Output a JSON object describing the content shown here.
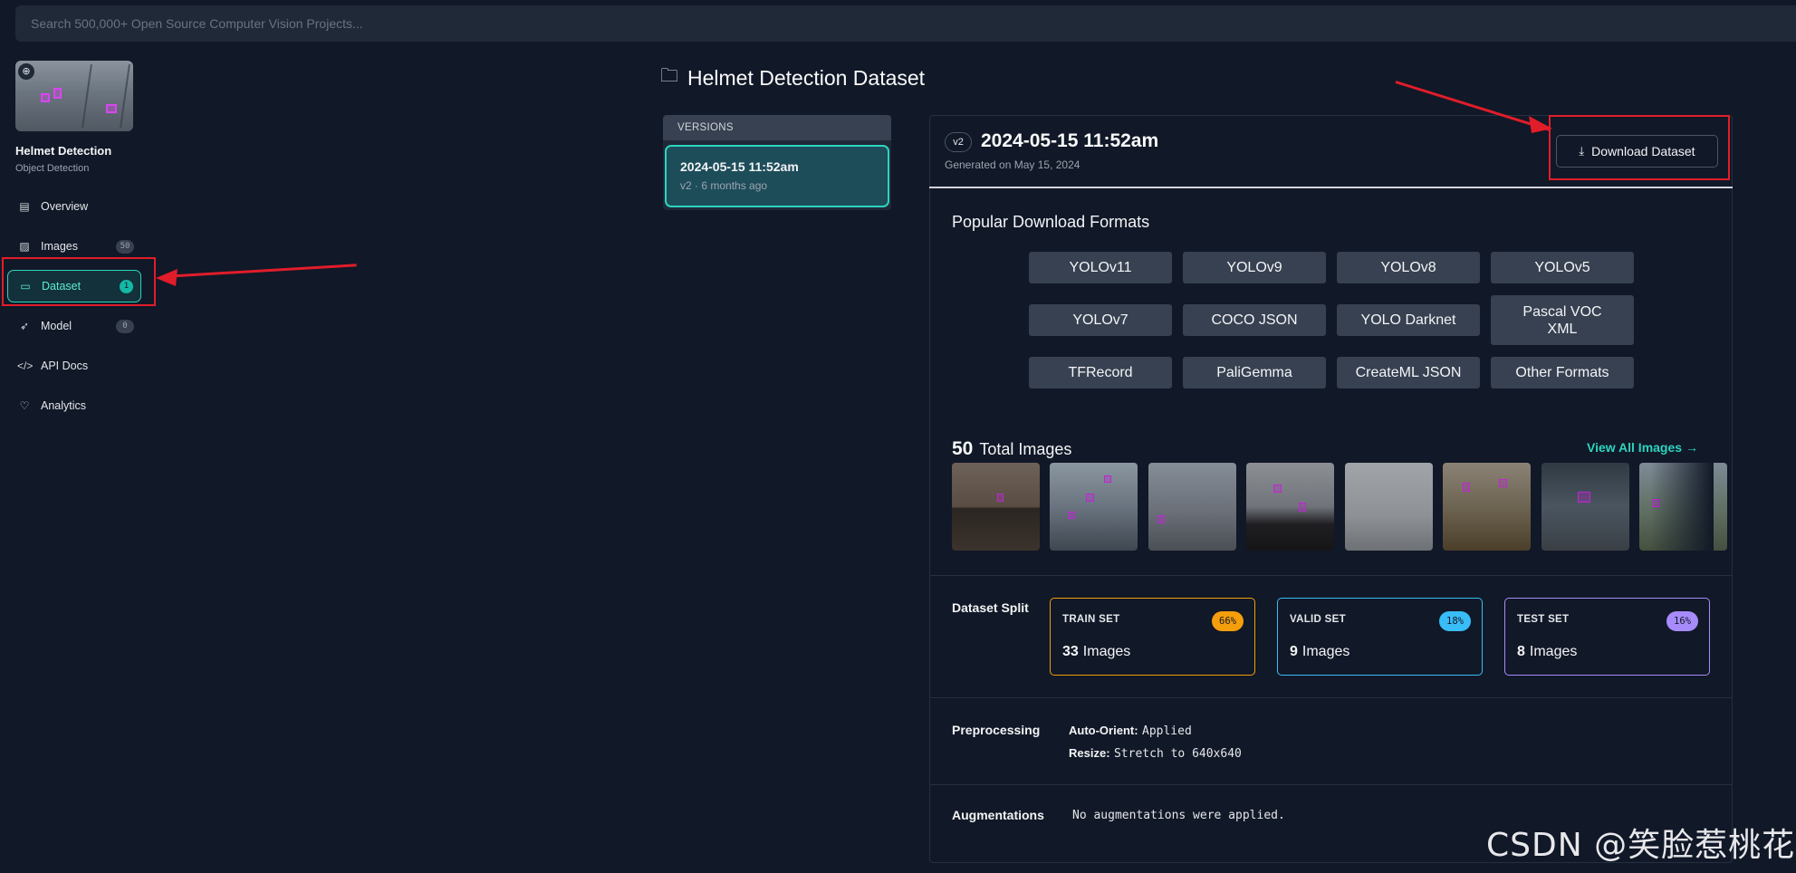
{
  "search": {
    "placeholder": "Search 500,000+ Open Source Computer Vision Projects..."
  },
  "project": {
    "name": "Helmet Detection",
    "type": "Object Detection"
  },
  "sidebar": {
    "items": [
      {
        "label": "Overview",
        "icon": "document-icon"
      },
      {
        "label": "Images",
        "icon": "images-icon",
        "count": "50"
      },
      {
        "label": "Dataset",
        "icon": "folder-icon",
        "count": "1",
        "active": true
      },
      {
        "label": "Model",
        "icon": "rocket-icon",
        "count": "0"
      },
      {
        "label": "API Docs",
        "icon": "code-icon"
      },
      {
        "label": "Analytics",
        "icon": "heart-pulse-icon"
      }
    ]
  },
  "page": {
    "title": "Helmet Detection Dataset"
  },
  "versions": {
    "header": "VERSIONS",
    "items": [
      {
        "date": "2024-05-15 11:52am",
        "meta": "v2 · 6 months ago"
      }
    ]
  },
  "version": {
    "badge": "v2",
    "title": "2024-05-15 11:52am",
    "generated": "Generated on May 15, 2024",
    "download_label": "Download Dataset"
  },
  "formats": {
    "title": "Popular Download Formats",
    "items": [
      "YOLOv11",
      "YOLOv9",
      "YOLOv8",
      "YOLOv5",
      "YOLOv7",
      "COCO JSON",
      "YOLO Darknet",
      "Pascal VOC XML",
      "TFRecord",
      "PaliGemma",
      "CreateML JSON",
      "Other Formats"
    ]
  },
  "images": {
    "total": "50",
    "total_label": "Total Images",
    "view_all": "View All Images →"
  },
  "split": {
    "label": "Dataset Split",
    "sets": [
      {
        "name": "TRAIN SET",
        "percent": "66%",
        "count": "33",
        "unit": "Images",
        "color": "#f59e0b"
      },
      {
        "name": "VALID SET",
        "percent": "18%",
        "count": "9",
        "unit": "Images",
        "color": "#38bdf8"
      },
      {
        "name": "TEST SET",
        "percent": "16%",
        "count": "8",
        "unit": "Images",
        "color": "#a78bfa"
      }
    ]
  },
  "preprocessing": {
    "label": "Preprocessing",
    "items": [
      {
        "key": "Auto-Orient:",
        "value": "Applied"
      },
      {
        "key": "Resize:",
        "value": "Stretch to 640x640"
      }
    ]
  },
  "augmentations": {
    "label": "Augmentations",
    "value": "No augmentations were applied."
  },
  "watermark": "CSDN @笑脸惹桃花",
  "colors": {
    "accent": "#2dd4bf",
    "annotation_red": "#e11d2a",
    "background": "#111827"
  }
}
